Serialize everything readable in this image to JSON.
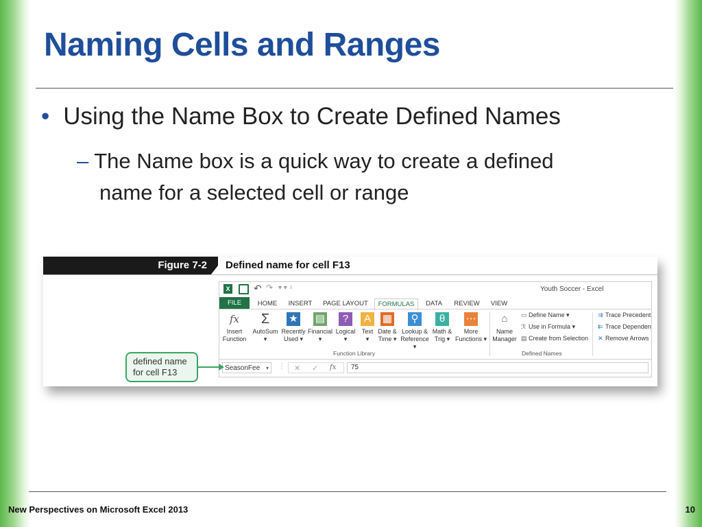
{
  "slide": {
    "title": "Naming Cells and Ranges",
    "bullet1": "Using the Name Box to Create Defined Names",
    "bullet2_line1": "The Name box is a quick way to create a defined",
    "bullet2_line2": "name for a selected cell or range",
    "footer": "New Perspectives on Microsoft Excel 2013",
    "page_number": "10"
  },
  "figure": {
    "number": "Figure 7-2",
    "caption": "Defined name for cell F13"
  },
  "excel": {
    "logo": "X",
    "window_title": "Youth Soccer - Excel",
    "tabs": [
      "FILE",
      "HOME",
      "INSERT",
      "PAGE LAYOUT",
      "FORMULAS",
      "DATA",
      "REVIEW",
      "VIEW"
    ],
    "active_tab": "FORMULAS",
    "function_library": {
      "label": "Function Library",
      "insert_function": [
        "Insert",
        "Function"
      ],
      "autosum": [
        "AutoSum",
        "▾"
      ],
      "recently_used": [
        "Recently",
        "Used ▾"
      ],
      "financial": [
        "Financial",
        "▾"
      ],
      "logical": [
        "Logical",
        "▾"
      ],
      "text": [
        "Text",
        "▾"
      ],
      "date_time": [
        "Date &",
        "Time ▾"
      ],
      "lookup_reference": [
        "Lookup &",
        "Reference ▾"
      ],
      "math_trig": [
        "Math &",
        "Trig ▾"
      ],
      "more_functions": [
        "More",
        "Functions ▾"
      ]
    },
    "defined_names": {
      "label": "Defined Names",
      "name_manager": [
        "Name",
        "Manager"
      ],
      "define_name": "Define Name  ▾",
      "use_in_formula": "Use in Formula ▾",
      "create_from_selection": "Create from Selection"
    },
    "formula_auditing": {
      "trace_precedents": "Trace Precedents",
      "trace_dependents": "Trace Dependents",
      "remove_arrows": "Remove Arrows"
    },
    "formula_bar": {
      "name_box": "SeasonFee",
      "value": "75",
      "fx": "fx"
    }
  },
  "callout": {
    "line1": "defined name",
    "line2": "for cell F13"
  },
  "colors": {
    "title": "#1f4e9a",
    "excel_green": "#217346",
    "callout_green": "#3aa563"
  }
}
